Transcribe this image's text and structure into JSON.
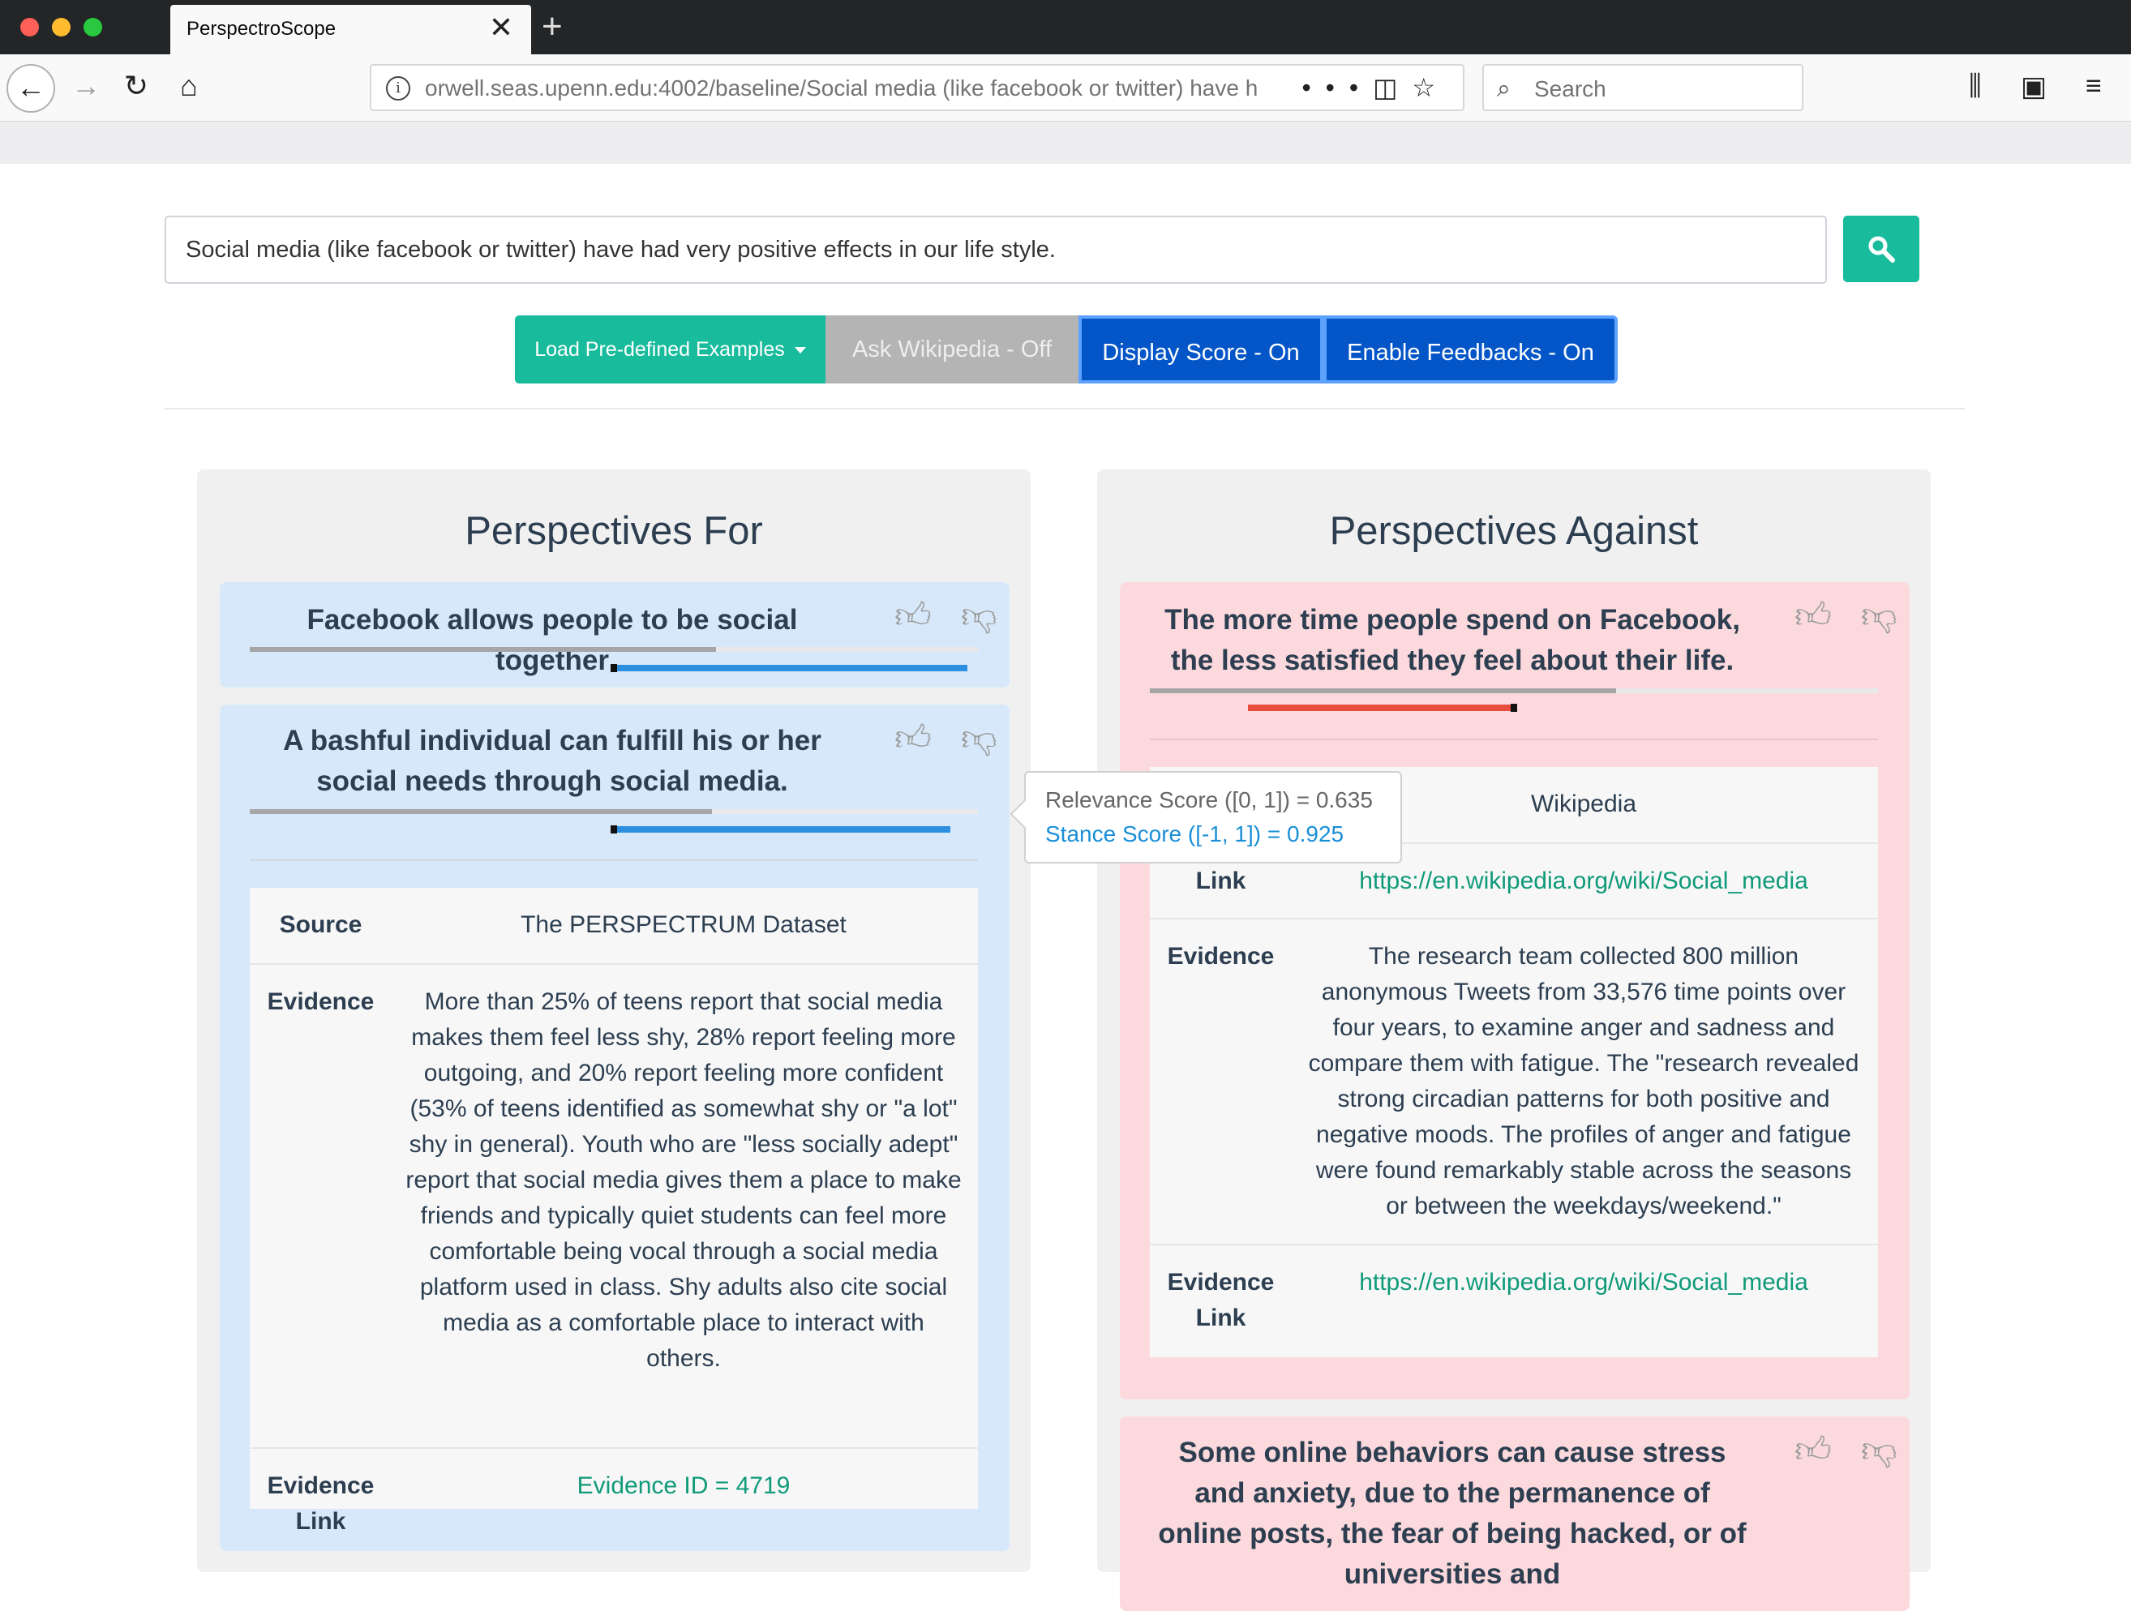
{
  "browser": {
    "tab_title": "PerspectroScope",
    "url": "orwell.seas.upenn.edu:4002/baseline/Social media (like facebook or twitter) have h",
    "search_placeholder": "Search"
  },
  "query": {
    "value": "Social media (like facebook or twitter) have had very positive effects in our life style."
  },
  "buttons": {
    "load_examples": "Load Pre-defined Examples",
    "ask_wikipedia": "Ask Wikipedia - Off",
    "display_score": "Display Score - On",
    "enable_feedbacks": "Enable Feedbacks - On"
  },
  "colors": {
    "accent_green": "#18bc9c",
    "toggle_on_blue": "#0456c8",
    "toggle_off_gray": "#b4b4b4",
    "for_card": "#d7e8fa",
    "against_card": "#fbd9dd",
    "stance_positive": "#2d8fe0",
    "stance_negative": "#e74c3c"
  },
  "perspectives_for": {
    "title": "Perspectives For",
    "items": [
      {
        "claim": "Facebook allows people to be social together",
        "relevance": 0.64,
        "stance": 0.97
      },
      {
        "claim": "A bashful individual can fulfill his or her social needs through social media.",
        "relevance": 0.635,
        "stance": 0.925,
        "source_label": "Source",
        "source": "The PERSPECTRUM Dataset",
        "evidence_label": "Evidence",
        "evidence": "More than 25% of teens report that social media makes them feel less shy, 28% report feeling more outgoing, and 20% report feeling more confident (53% of teens identified as somewhat shy or \"a lot\" shy in general). Youth who are \"less socially adept\" report that social media gives them a place to make friends and typically quiet students can feel more comfortable being vocal through a social media platform used in class. Shy adults also cite social media as a comfortable place to interact with others.",
        "evidence_link_label": "Evidence Link",
        "evidence_link": "Evidence ID = 4719"
      }
    ]
  },
  "perspectives_against": {
    "title": "Perspectives Against",
    "items": [
      {
        "claim": "The more time people spend on Facebook, the less satisfied they feel about their life.",
        "relevance": 0.64,
        "stance": -0.73,
        "source": "Wikipedia",
        "link_label": "Link",
        "link": "https://en.wikipedia.org/wiki/Social_media",
        "evidence_label": "Evidence",
        "evidence": "The research team collected 800 million anonymous Tweets from 33,576 time points over four years, to examine anger and sadness and compare them with fatigue. The \"research revealed strong circadian patterns for both positive and negative moods. The profiles of anger and fatigue were found remarkably stable across the seasons or between the weekdays/weekend.\"",
        "evidence_link_label": "Evidence Link",
        "evidence_link": "https://en.wikipedia.org/wiki/Social_media"
      },
      {
        "claim": "Some online behaviors can cause stress and anxiety, due to the permanence of online posts, the fear of being hacked, or of universities and"
      }
    ]
  },
  "tooltip": {
    "relevance": "Relevance Score ([0, 1]) = 0.635",
    "stance": "Stance Score ([-1, 1]) = 0.925"
  },
  "icons": {
    "thumb_up": "thumbs-up-icon",
    "thumb_down": "thumbs-down-icon",
    "search": "search-icon"
  }
}
